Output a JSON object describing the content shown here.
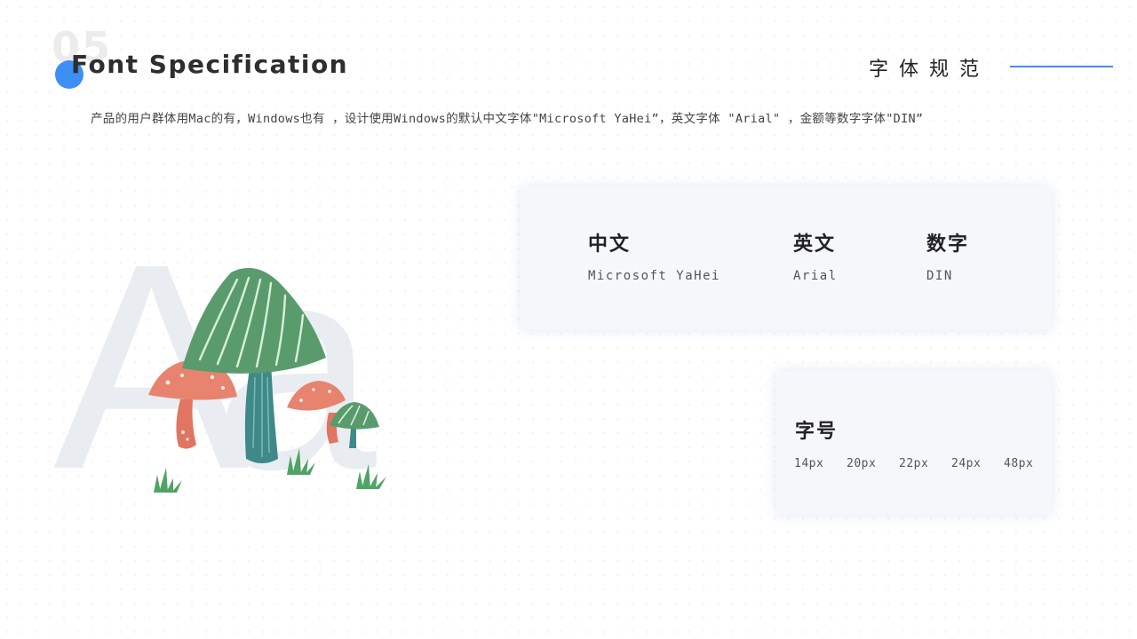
{
  "header": {
    "section_number": "05",
    "title": "Font Specification",
    "cn_title": "字体规范",
    "description": "产品的用户群体用Mac的有，Windows也有 ，设计使用Windows的默认中文字体\"Microsoft YaHei”，英文字体 \"Arial\" ，金额等数字字体\"DIN”"
  },
  "fonts": [
    {
      "label": "中文",
      "value": "Microsoft YaHei"
    },
    {
      "label": "英文",
      "value": "Arial"
    },
    {
      "label": "数字",
      "value": "DIN"
    }
  ],
  "sizes": {
    "label": "字号",
    "values": [
      "14px",
      "20px",
      "22px",
      "24px",
      "48px"
    ]
  },
  "illustration": {
    "letters": "Aa"
  },
  "colors": {
    "accent": "#3d8ef5",
    "card_bg": "#f5f7fa",
    "mushroom_green": "#5a9b6e",
    "mushroom_teal": "#3f8a88",
    "mushroom_red": "#e57f6b"
  }
}
